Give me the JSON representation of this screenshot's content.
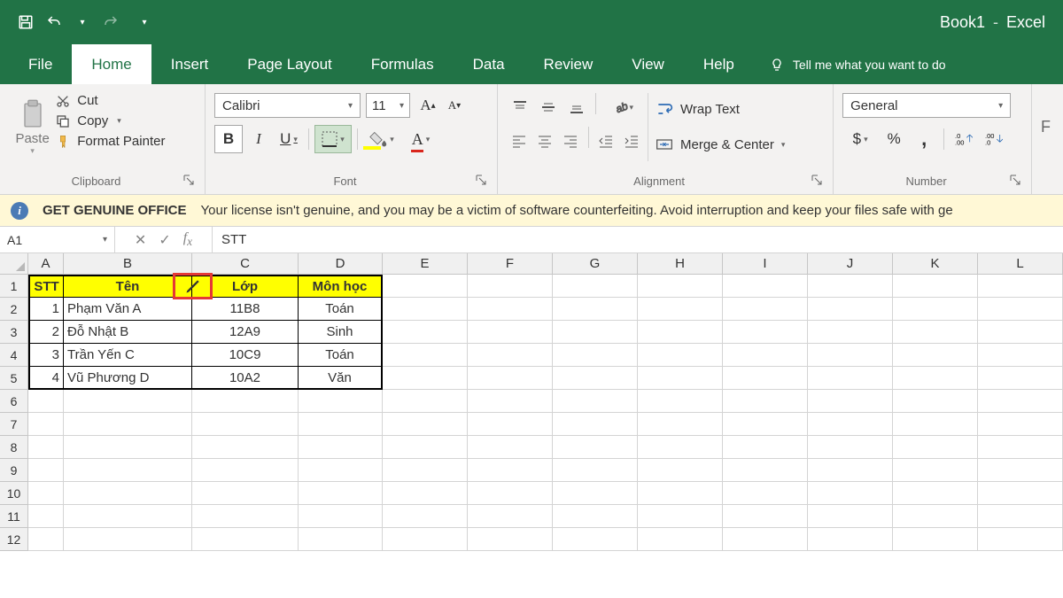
{
  "app": {
    "doc": "Book1",
    "name": "Excel"
  },
  "tabs": [
    "File",
    "Home",
    "Insert",
    "Page Layout",
    "Formulas",
    "Data",
    "Review",
    "View",
    "Help"
  ],
  "active_tab": "Home",
  "tellme": "Tell me what you want to do",
  "ribbon": {
    "clipboard": {
      "paste": "Paste",
      "cut": "Cut",
      "copy": "Copy",
      "fmtpainter": "Format Painter",
      "label": "Clipboard"
    },
    "font": {
      "name": "Calibri",
      "size": "11",
      "grow": "A",
      "shrink": "A",
      "bold": "B",
      "italic": "I",
      "underline": "U",
      "label": "Font"
    },
    "align": {
      "wrap": "Wrap Text",
      "merge": "Merge & Center",
      "label": "Alignment"
    },
    "number": {
      "fmt": "General",
      "currency": "$",
      "percent": "%",
      "comma": ",",
      "label": "Number"
    }
  },
  "warning": {
    "title": "GET GENUINE OFFICE",
    "text": "Your license isn't genuine, and you may be a victim of software counterfeiting. Avoid interruption and keep your files safe with ge"
  },
  "namebox": "A1",
  "formula": "STT",
  "columns": [
    "A",
    "B",
    "C",
    "D",
    "E",
    "F",
    "G",
    "H",
    "I",
    "J",
    "K",
    "L"
  ],
  "col_widths": {
    "A": "cA",
    "B": "cB",
    "C": "cC",
    "D": "cD"
  },
  "headers": {
    "A": "STT",
    "B": "Tên",
    "C": "Lớp",
    "D": "Môn học"
  },
  "rows": [
    {
      "A": "1",
      "B": "Phạm Văn A",
      "C": "11B8",
      "D": "Toán"
    },
    {
      "A": "2",
      "B": "Đỗ Nhật B",
      "C": "12A9",
      "D": "Sinh"
    },
    {
      "A": "3",
      "B": "Trần Yến C",
      "C": "10C9",
      "D": "Toán"
    },
    {
      "A": "4",
      "B": "Vũ Phương D",
      "C": "10A2",
      "D": "Văn"
    }
  ],
  "visible_rows": 12
}
